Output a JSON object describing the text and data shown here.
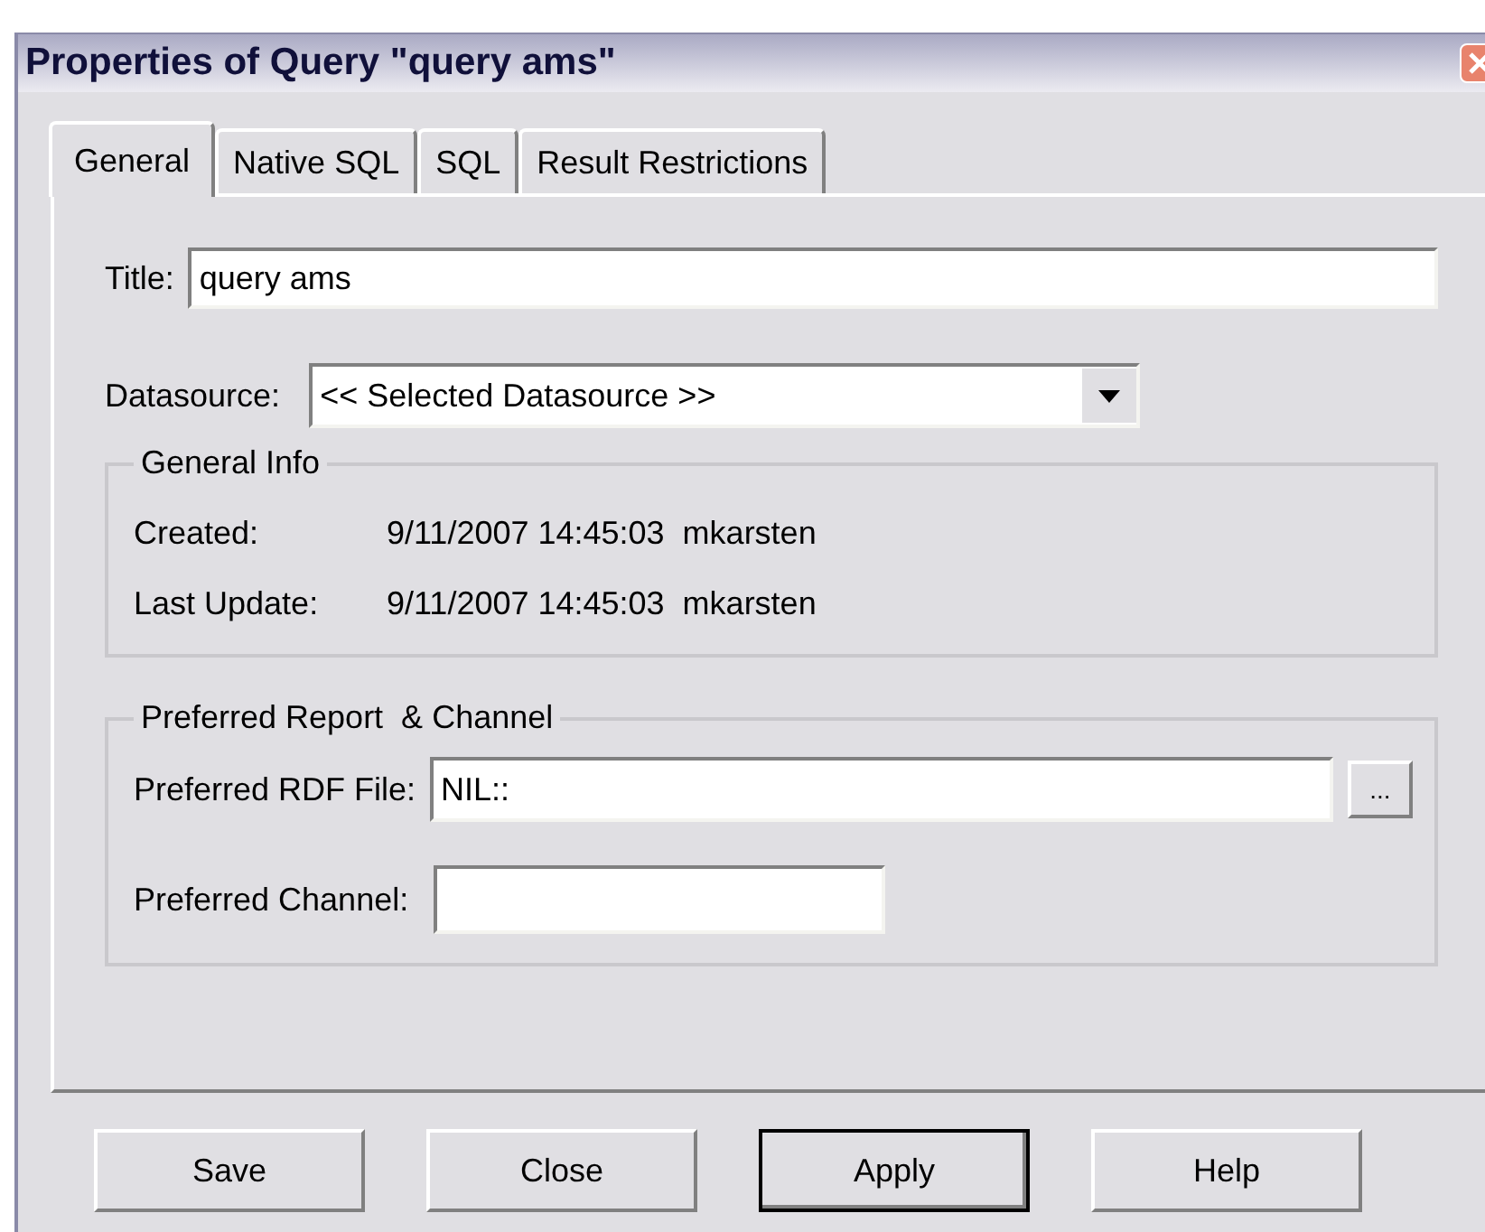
{
  "window": {
    "title": "Properties of Query \"query ams\""
  },
  "tabs": [
    {
      "label": "General",
      "selected": true
    },
    {
      "label": "Native SQL",
      "selected": false
    },
    {
      "label": "SQL",
      "selected": false
    },
    {
      "label": "Result Restrictions",
      "selected": false
    }
  ],
  "title_field": {
    "label": "Title:",
    "value": "query ams"
  },
  "datasource": {
    "label": "Datasource:",
    "value": "<< Selected Datasource >>"
  },
  "general_info": {
    "heading": "General Info",
    "rows": [
      {
        "label": "Created:",
        "value": "9/11/2007 14:45:03  mkarsten"
      },
      {
        "label": "Last Update:",
        "value": "9/11/2007 14:45:03  mkarsten"
      }
    ]
  },
  "preferred": {
    "heading": "Preferred Report  & Channel",
    "rdf_label": "Preferred RDF File:",
    "rdf_value": "NIL::",
    "browse": "...",
    "channel_label": "Preferred Channel:"
  },
  "buttons": [
    {
      "label": "Save",
      "default": false
    },
    {
      "label": "Close",
      "default": false
    },
    {
      "label": "Apply",
      "default": true
    },
    {
      "label": "Help",
      "default": false
    }
  ]
}
